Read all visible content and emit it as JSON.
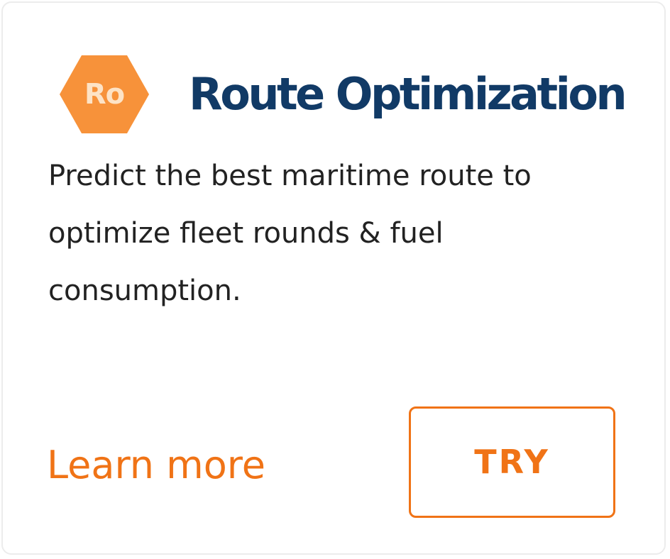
{
  "card": {
    "badge": {
      "text": "Ro",
      "icon": "hexagon-icon",
      "color": "#F7923A"
    },
    "title": "Route Optimization",
    "description": "Predict the best maritime route to optimize fleet rounds & fuel consumption.",
    "learn_more_label": "Learn more",
    "try_label": "TRY"
  },
  "colors": {
    "title": "#113A66",
    "accent": "#F07316",
    "body_text": "#222222"
  }
}
